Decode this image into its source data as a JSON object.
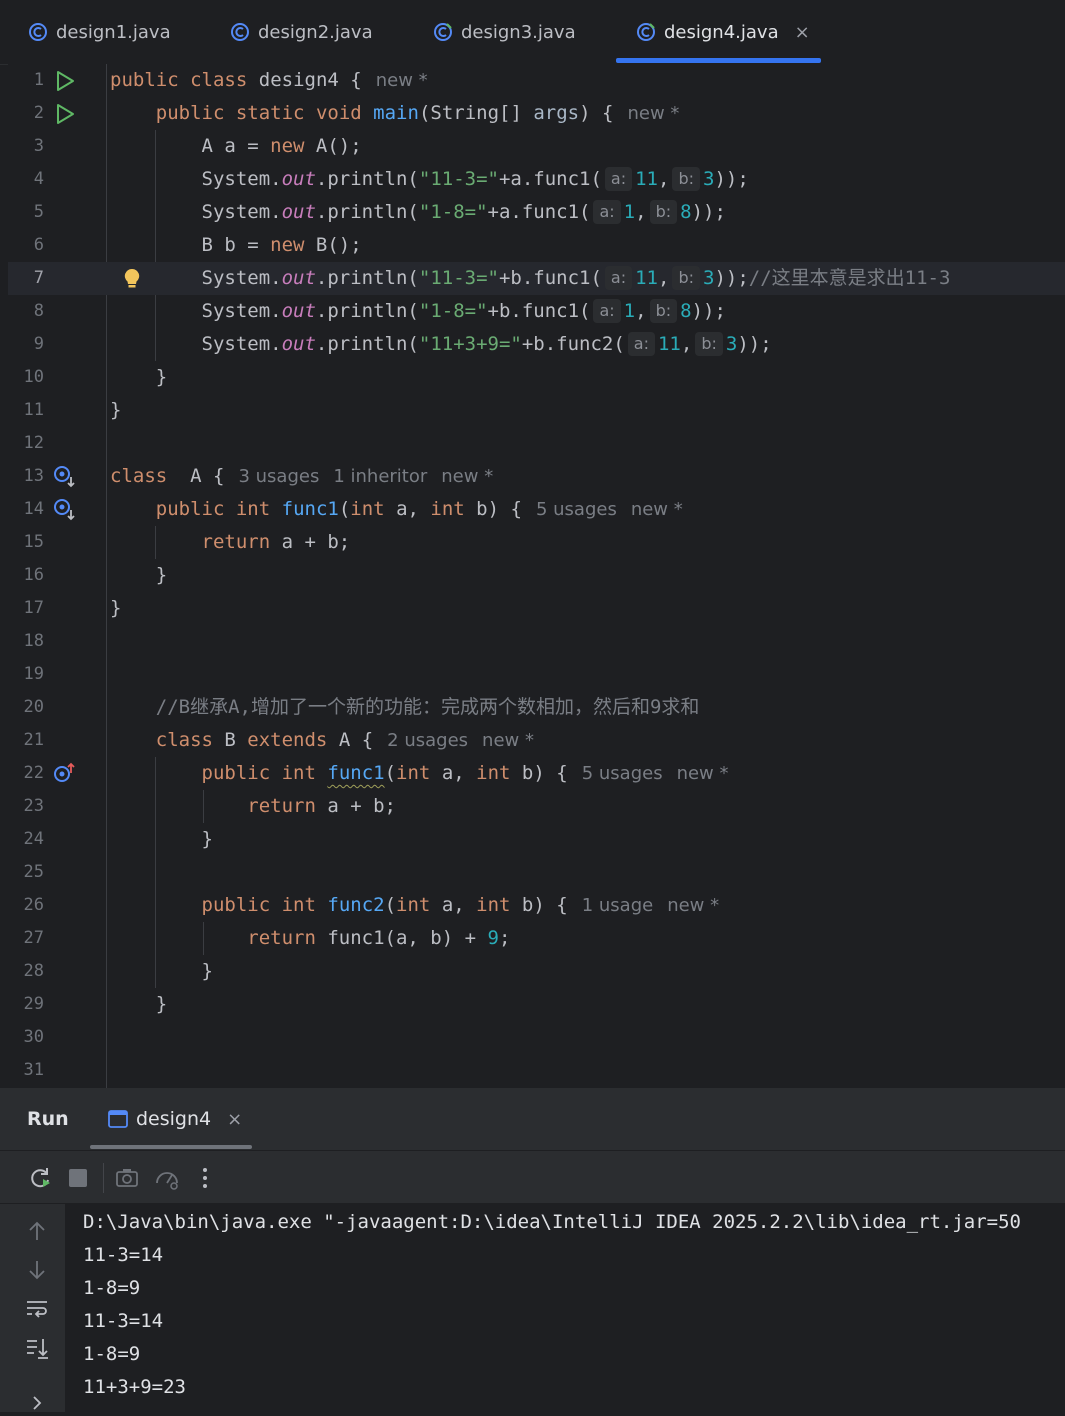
{
  "tabs": [
    {
      "label": "design1.java",
      "active": false
    },
    {
      "label": "design2.java",
      "active": false
    },
    {
      "label": "design3.java",
      "active": false
    },
    {
      "label": "design4.java",
      "active": true
    }
  ],
  "tab_close": "×",
  "code_lines": [
    {
      "n": "1"
    },
    {
      "n": "2"
    },
    {
      "n": "3"
    },
    {
      "n": "4"
    },
    {
      "n": "5"
    },
    {
      "n": "6"
    },
    {
      "n": "7"
    },
    {
      "n": "8"
    },
    {
      "n": "9"
    },
    {
      "n": "10"
    },
    {
      "n": "11"
    },
    {
      "n": "12"
    },
    {
      "n": "13"
    },
    {
      "n": "14"
    },
    {
      "n": "15"
    },
    {
      "n": "16"
    },
    {
      "n": "17"
    },
    {
      "n": "18"
    },
    {
      "n": "19"
    },
    {
      "n": "20"
    },
    {
      "n": "21"
    },
    {
      "n": "22"
    },
    {
      "n": "23"
    },
    {
      "n": "24"
    },
    {
      "n": "25"
    },
    {
      "n": "26"
    },
    {
      "n": "27"
    },
    {
      "n": "28"
    },
    {
      "n": "29"
    },
    {
      "n": "30"
    },
    {
      "n": "31"
    }
  ],
  "code": {
    "l1": {
      "kw1": "public",
      "kw2": "class",
      "name": "design4",
      "brace": "{",
      "lens": "new *"
    },
    "l2": {
      "kw1": "public",
      "kw2": "static",
      "kw3": "void",
      "fn": "main",
      "params1": "(String[]",
      "param": "args",
      "rest": ")",
      "brace": "{",
      "lens": "new *"
    },
    "l3": {
      "t1": "A a = ",
      "kw": "new",
      "t2": " A();"
    },
    "l4": {
      "sys": "System.",
      "out": "out",
      "t1": ".println(",
      "str": "\"11-3=\"",
      "t2": "+a.func1(",
      "ha": "a:",
      "v1": "11",
      "comma": ",",
      "hb": "b:",
      "v2": "3",
      "t3": "));"
    },
    "l5": {
      "sys": "System.",
      "out": "out",
      "t1": ".println(",
      "str": "\"1-8=\"",
      "t2": "+a.func1(",
      "ha": "a:",
      "v1": "1",
      "comma": ",",
      "hb": "b:",
      "v2": "8",
      "t3": "));"
    },
    "l6": {
      "t1": "B b = ",
      "kw": "new",
      "t2": " B();"
    },
    "l7": {
      "sys": "System.",
      "out": "out",
      "t1": ".println(",
      "str": "\"11-3=\"",
      "t2": "+b.func1(",
      "ha": "a:",
      "v1": "11",
      "comma": ",",
      "hb": "b:",
      "v2": "3",
      "t3": "));",
      "cm": "//这里本意是求出11-3"
    },
    "l8": {
      "sys": "System.",
      "out": "out",
      "t1": ".println(",
      "str": "\"1-8=\"",
      "t2": "+b.func1(",
      "ha": "a:",
      "v1": "1",
      "comma": ",",
      "hb": "b:",
      "v2": "8",
      "t3": "));"
    },
    "l9": {
      "sys": "System.",
      "out": "out",
      "t1": ".println(",
      "str": "\"11+3+9=\"",
      "t2": "+b.func2(",
      "ha": "a:",
      "v1": "11",
      "comma": ",",
      "hb": "b:",
      "v2": "3",
      "t3": "));"
    },
    "l10": "}",
    "l11": "}",
    "l13": {
      "kw": "class",
      "name": "A",
      "brace": "{",
      "lens1": "3 usages",
      "lens2": "1 inheritor",
      "lens3": "new *"
    },
    "l14": {
      "kw1": "public",
      "kw2": "int",
      "fn": "func1",
      "p1": "(",
      "kw3": "int",
      "p2": " a, ",
      "kw4": "int",
      "p3": " b)",
      "brace": "{",
      "lens1": "5 usages",
      "lens2": "new *"
    },
    "l15": {
      "kw": "return",
      "t": " a + b;"
    },
    "l16": "}",
    "l17": "}",
    "l20": "//B继承A,增加了一个新的功能：完成两个数相加，然后和9求和",
    "l21": {
      "kw1": "class",
      "name": " B ",
      "kw2": "extends",
      "t": " A ",
      "brace": "{",
      "lens1": "2 usages",
      "lens2": "new *"
    },
    "l22": {
      "kw1": "public",
      "kw2": "int",
      "fn": "func1",
      "p1": "(",
      "kw3": "int",
      "p2": " a, ",
      "kw4": "int",
      "p3": " b)",
      "brace": "{",
      "lens1": "5 usages",
      "lens2": "new *"
    },
    "l23": {
      "kw": "return",
      "t": " a + b;"
    },
    "l24": "}",
    "l26": {
      "kw1": "public",
      "kw2": "int",
      "fn": "func2",
      "p1": "(",
      "kw3": "int",
      "p2": " a, ",
      "kw4": "int",
      "p3": " b)",
      "brace": "{",
      "lens1": "1 usage",
      "lens2": "new *"
    },
    "l27": {
      "kw": "return",
      "t1": " func1(a, b) + ",
      "num": "9",
      "t2": ";"
    },
    "l28": "}",
    "l29": "}"
  },
  "run": {
    "title": "Run",
    "tab_label": "design4",
    "close": "×"
  },
  "console": [
    "D:\\Java\\bin\\java.exe \"-javaagent:D:\\idea\\IntelliJ IDEA 2025.2.2\\lib\\idea_rt.jar=50",
    "11-3=14",
    "1-8=9",
    "11-3=14",
    "1-8=9",
    "11+3+9=23"
  ],
  "colors": {
    "accent": "#3574f0",
    "keyword": "#cf8e6d",
    "function": "#56a8f5",
    "string": "#6aab73",
    "number": "#2aacb8"
  },
  "icons": [
    "java-class-icon",
    "run-gutter-icon",
    "implemented-icon",
    "overrides-icon",
    "bulb-icon",
    "rerun-icon",
    "stop-icon",
    "screenshot-icon",
    "profiler-icon",
    "more-icon",
    "arrow-up-icon",
    "arrow-down-icon",
    "soft-wrap-icon",
    "scroll-to-end-icon"
  ]
}
